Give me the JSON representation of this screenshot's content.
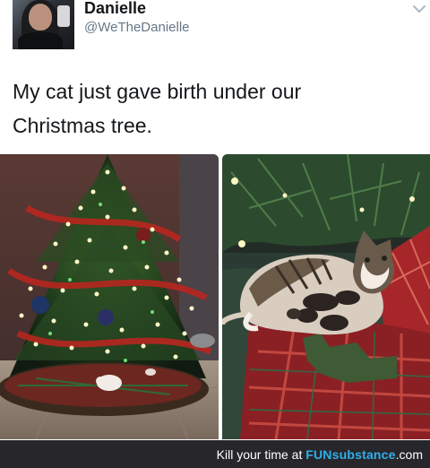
{
  "tweet": {
    "display_name": "Danielle",
    "handle": "@WeTheDanielle",
    "text_line1": "My cat just gave birth under our",
    "text_line2": "Christmas tree."
  },
  "icons": {
    "avatar": "profile-photo",
    "menu": "chevron-down-icon"
  },
  "photos": [
    {
      "name": "christmas-tree-photo"
    },
    {
      "name": "cat-with-kittens-photo"
    }
  ],
  "watermark": {
    "prefix": "Kill your time at ",
    "brand": "FUNsubstance",
    "suffix": ".com"
  },
  "colors": {
    "text": "#14171a",
    "handle": "#657786",
    "footer_bg": "#27262b",
    "brand": "#2fb0ea"
  }
}
